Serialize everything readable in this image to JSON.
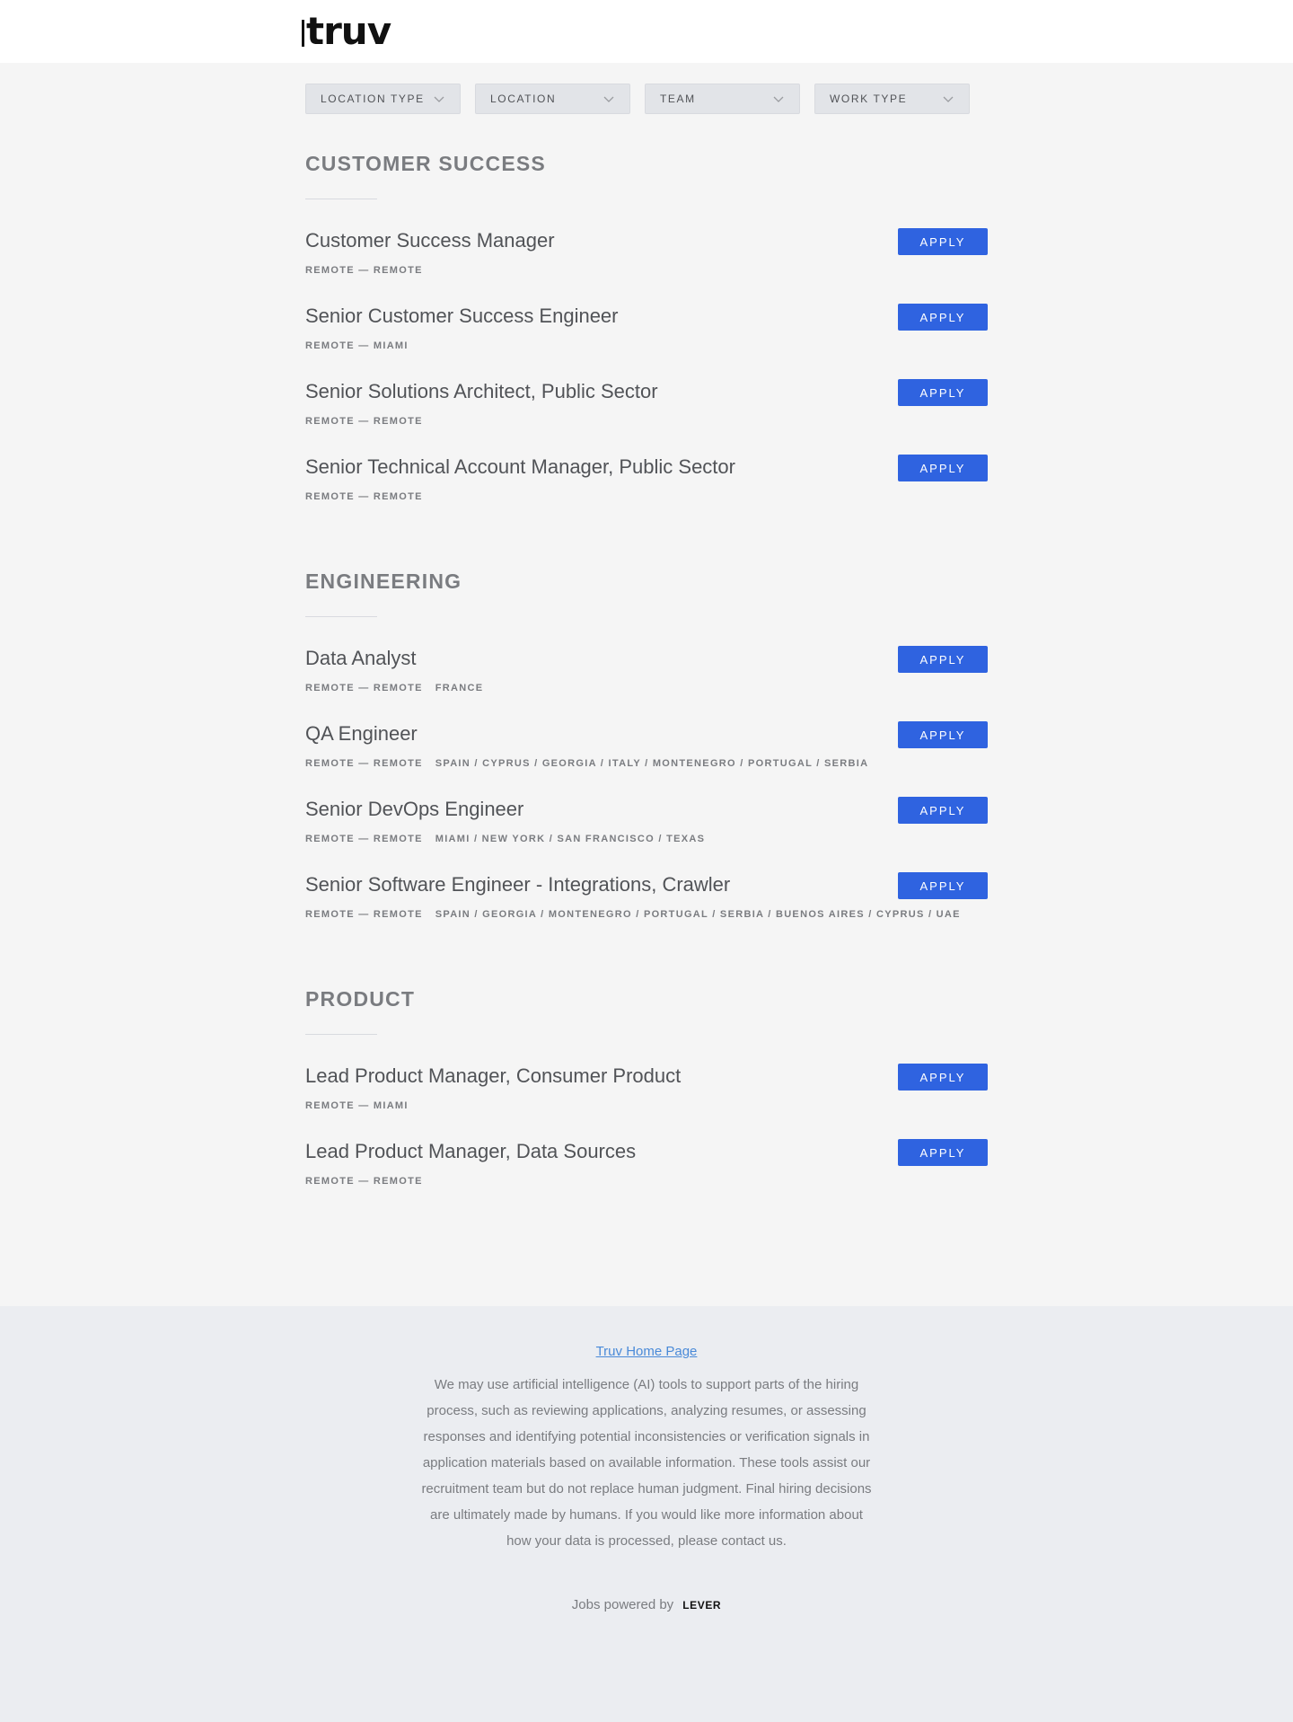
{
  "header": {
    "logo_text": "truv"
  },
  "filters": [
    {
      "label": "LOCATION TYPE"
    },
    {
      "label": "LOCATION"
    },
    {
      "label": "TEAM"
    },
    {
      "label": "WORK TYPE"
    }
  ],
  "apply_label": "APPLY",
  "teams": [
    {
      "title": "CUSTOMER SUCCESS",
      "postings": [
        {
          "title": "Customer Success Manager",
          "location": "REMOTE — REMOTE",
          "extra": ""
        },
        {
          "title": "Senior Customer Success Engineer",
          "location": "REMOTE — MIAMI",
          "extra": ""
        },
        {
          "title": "Senior Solutions Architect, Public Sector",
          "location": "REMOTE — REMOTE",
          "extra": ""
        },
        {
          "title": "Senior Technical Account Manager, Public Sector",
          "location": "REMOTE — REMOTE",
          "extra": ""
        }
      ]
    },
    {
      "title": "ENGINEERING",
      "postings": [
        {
          "title": "Data Analyst",
          "location": "REMOTE — REMOTE",
          "extra": "FRANCE"
        },
        {
          "title": "QA Engineer",
          "location": "REMOTE — REMOTE",
          "extra": "SPAIN / CYPRUS / GEORGIA / ITALY / MONTENEGRO / PORTUGAL / SERBIA"
        },
        {
          "title": "Senior DevOps Engineer",
          "location": "REMOTE — REMOTE",
          "extra": "MIAMI / NEW YORK / SAN FRANCISCO / TEXAS"
        },
        {
          "title": "Senior Software Engineer - Integrations, Crawler",
          "location": "REMOTE — REMOTE",
          "extra": "SPAIN / GEORGIA / MONTENEGRO / PORTUGAL / SERBIA / BUENOS AIRES / CYPRUS / UAE"
        }
      ]
    },
    {
      "title": "PRODUCT",
      "postings": [
        {
          "title": "Lead Product Manager, Consumer Product",
          "location": "REMOTE — MIAMI",
          "extra": ""
        },
        {
          "title": "Lead Product Manager, Data Sources",
          "location": "REMOTE — REMOTE",
          "extra": ""
        }
      ]
    }
  ],
  "footer": {
    "home_link": "Truv Home Page",
    "disclaimer": "We may use artificial intelligence (AI) tools to support parts of the hiring process, such as reviewing applications, analyzing resumes, or assessing responses and identifying potential inconsistencies or verification signals in application materials based on available information. These tools assist our recruitment team but do not replace human judgment. Final hiring decisions are ultimately made by humans. If you would like more information about how your data is processed, please contact us.",
    "powered_by": "Jobs powered by",
    "lever_logo": "LEVER"
  },
  "colors": {
    "accent": "#2f63e0",
    "link": "#4a8ad8",
    "background": "#f5f5f5",
    "footer_bg": "#ebedf1"
  }
}
